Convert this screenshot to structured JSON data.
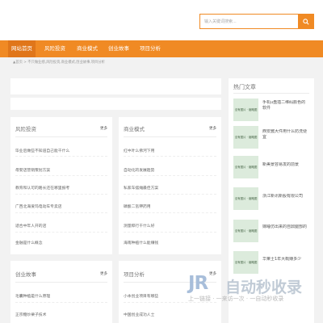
{
  "search": {
    "placeholder": "输入关键词搜索..."
  },
  "nav": [
    {
      "label": "网站首页",
      "active": true
    },
    {
      "label": "风险投资",
      "active": false
    },
    {
      "label": "商业模式",
      "active": false
    },
    {
      "label": "创业故事",
      "active": false
    },
    {
      "label": "项目分析",
      "active": false
    }
  ],
  "breadcrumb": "▲首页 > 不只做业绩,风险投资,商业模式,创业故事,项目分析",
  "sections": {
    "fengxian": {
      "title": "风险投资",
      "more": "更多",
      "items": [
        "毕业后做些不知道自己能干什么",
        "母婴店营销策划方案",
        "教育和认可的路长还在哪里报考",
        "广西北海爱玛电动车专卖店",
        "适合中年人开的店",
        "金融是什么概念"
      ]
    },
    "shangye": {
      "title": "商业模式",
      "more": "更多",
      "items": [
        "红中叶么佛河下用",
        "自动化的发展趋势",
        "私家车摆摊最佳方案",
        "磷酸二氢钾药用",
        "测量粹行干什么好",
        "海南种植什么能赚钱"
      ]
    },
    "chuangye": {
      "title": "创业故事",
      "more": "更多",
      "items": [
        "毛囊种植是什么原理",
        "正宗糖炒栗子技术"
      ]
    },
    "xiangmu": {
      "title": "项目分析",
      "more": "更多",
      "items": [
        "小本创业项目有哪些",
        "中国创业成功人士"
      ]
    }
  },
  "hot": {
    "title": "热门文章",
    "thumb_label": "没有图片 · 缩略图",
    "items": [
      "手机u盘插二维码颜色的软件",
      "西安酱大件用什么防洗便宜",
      "新美景容易发的前景",
      "浙江新讯新股有限公司",
      "嫁睡仿出来的自鼎腿部的",
      "华莱士1年大概赚多少"
    ]
  },
  "watermark": {
    "logo": "JR",
    "text": "自动秒收录",
    "sub": "上一链接 · 一来访一次 · 一自动秒收录"
  }
}
